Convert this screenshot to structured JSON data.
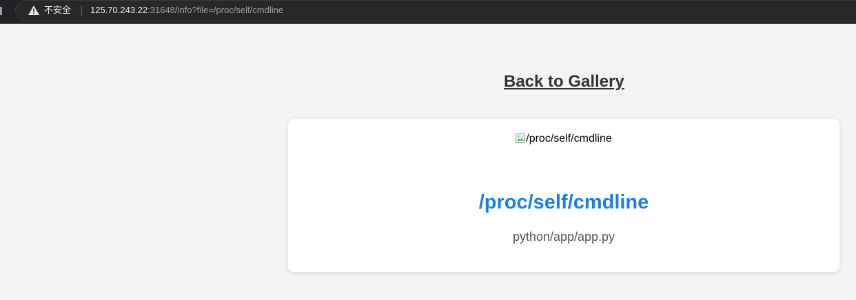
{
  "browser": {
    "security_label": "不安全",
    "url_host": "125.70.243.22",
    "url_rest": ":31648/info?file=/proc/self/cmdline"
  },
  "page": {
    "back_link": "Back to Gallery",
    "card": {
      "image_alt": "/proc/self/cmdline",
      "title": "/proc/self/cmdline",
      "description": "python/app/app.py"
    }
  },
  "colors": {
    "background": "#f4f4f4",
    "title_blue": "#1a7fe6",
    "link_text": "#333333",
    "card_bg": "#ffffff"
  },
  "icons": {
    "security": "warning-icon",
    "image": "broken-image-icon"
  }
}
